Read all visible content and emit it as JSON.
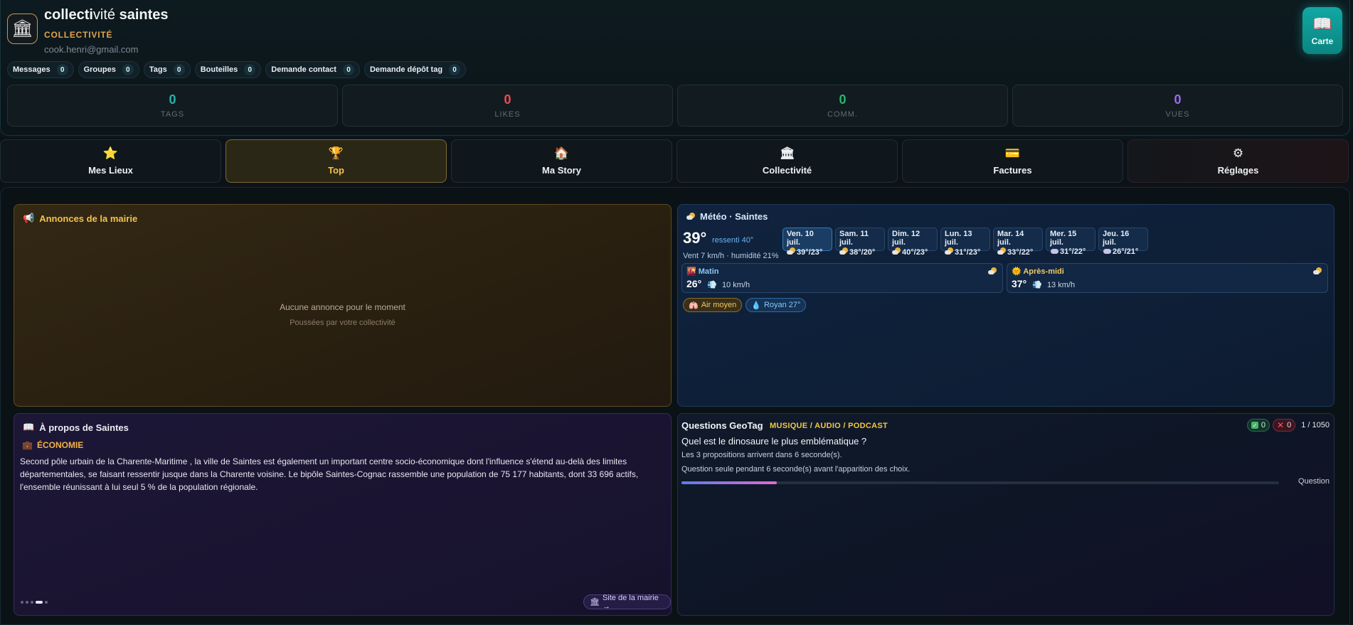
{
  "header": {
    "org_name_prefix": "collecti",
    "org_name_mid": "vité",
    "org_name_suffix": " saintes",
    "org_type": "COLLECTIVITÉ",
    "email": "cook.henri@gmail.com",
    "carte_label": "Carte"
  },
  "pills": [
    {
      "label": "Messages",
      "count": "0"
    },
    {
      "label": "Groupes",
      "count": "0"
    },
    {
      "label": "Tags",
      "count": "0"
    },
    {
      "label": "Bouteilles",
      "count": "0"
    },
    {
      "label": "Demande contact",
      "count": "0"
    },
    {
      "label": "Demande dépôt tag",
      "count": "0"
    }
  ],
  "stats": [
    {
      "value": "0",
      "label": "TAGS",
      "color": "#27b5a7"
    },
    {
      "value": "0",
      "label": "LIKES",
      "color": "#f04b53"
    },
    {
      "value": "0",
      "label": "COMM.",
      "color": "#25b86e"
    },
    {
      "value": "0",
      "label": "VUES",
      "color": "#9b6cf0"
    }
  ],
  "tabs": [
    {
      "label": "Mes Lieux",
      "icon": "star-icon"
    },
    {
      "label": "Top",
      "icon": "trophy-icon"
    },
    {
      "label": "Ma Story",
      "icon": "house-icon"
    },
    {
      "label": "Collectivité",
      "icon": "bank-icon"
    },
    {
      "label": "Factures",
      "icon": "credit-card-icon"
    },
    {
      "label": "Réglages",
      "icon": "gear-icon"
    }
  ],
  "annonces": {
    "title": "Annonces de la mairie",
    "empty": "Aucune annonce pour le moment",
    "sub": "Poussées par votre collectivité"
  },
  "meteo": {
    "title": "Météo · Saintes",
    "temp": "39°",
    "feel": "ressenti 40°",
    "wind": "Vent 7 km/h · humidité 21%",
    "days": [
      {
        "name": "Ven. 10 juil.",
        "temps": "39°/23°",
        "icon": "sun-cloud-icon"
      },
      {
        "name": "Sam. 11 juil.",
        "temps": "38°/20°",
        "icon": "sun-cloud-icon"
      },
      {
        "name": "Dim. 12 juil.",
        "temps": "40°/23°",
        "icon": "sun-cloud-icon"
      },
      {
        "name": "Lun. 13 juil.",
        "temps": "31°/23°",
        "icon": "sun-cloud-icon"
      },
      {
        "name": "Mar. 14 juil.",
        "temps": "33°/22°",
        "icon": "sun-cloud-icon"
      },
      {
        "name": "Mer. 15 juil.",
        "temps": "31°/22°",
        "icon": "cloud-icon"
      },
      {
        "name": "Jeu. 16 juil.",
        "temps": "26°/21°",
        "icon": "cloud-icon"
      }
    ],
    "morning": {
      "label": "Matin",
      "temp": "26°",
      "wind": "10 km/h"
    },
    "afternoon": {
      "label": "Après-midi",
      "temp": "37°",
      "wind": "13 km/h"
    },
    "air": "Air moyen",
    "sea": "Royan 27°"
  },
  "apropos": {
    "title": "À propos de Saintes",
    "section": "ÉCONOMIE",
    "text": "Second pôle urbain de la Charente-Maritime , la ville de Saintes est également un important centre socio-économique dont l'influence s'étend au-delà des limites départementales, se faisant ressentir jusque dans la Charente voisine. Le bipôle Saintes-Cognac rassemble une population de 75 177 habitants, dont 33 696 actifs, l'ensemble réunissant à lui seul 5 % de la population régionale.",
    "site_label": "Site de la mairie →"
  },
  "geotag": {
    "title": "Questions GeoTag",
    "category": "MUSIQUE / AUDIO / PODCAST",
    "ok": "0",
    "ko": "0",
    "count": "1 / 1050",
    "question": "Quel est le dinosaure le plus emblématique ?",
    "line1": "Les 3 propositions arrivent dans 6 seconde(s).",
    "line2": "Question seule pendant 6 seconde(s) avant l'apparition des choix.",
    "progress": 0.16,
    "progress_label": "Question"
  }
}
